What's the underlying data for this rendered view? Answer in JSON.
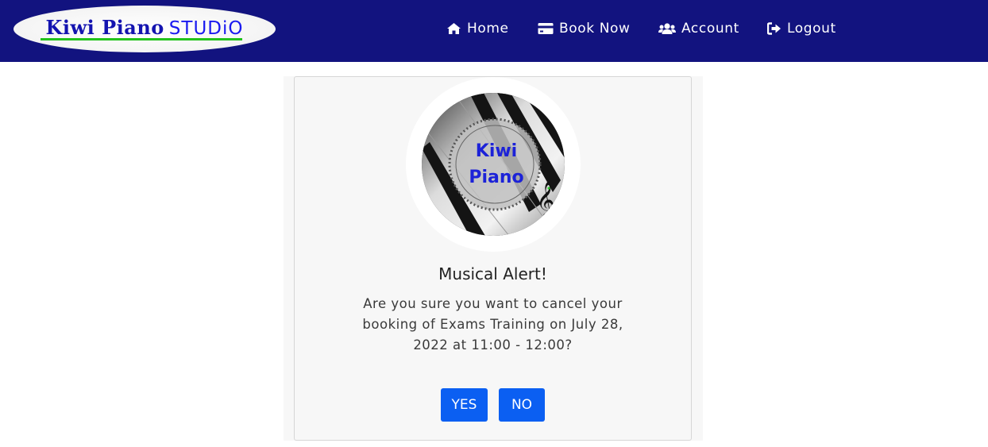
{
  "navbar": {
    "logo": {
      "brand": "Kiwi Piano",
      "suffix": "STUDiO"
    },
    "items": [
      {
        "label": "Home",
        "icon": "home-icon"
      },
      {
        "label": "Book Now",
        "icon": "credit-card-icon"
      },
      {
        "label": "Account",
        "icon": "users-icon"
      },
      {
        "label": "Logout",
        "icon": "sign-out-icon"
      }
    ]
  },
  "dialog": {
    "avatar_text_line1": "Kiwi",
    "avatar_text_line2": "Piano",
    "title": "Musical Alert!",
    "message": "Are you sure you want to cancel your booking of Exams Training on July 28, 2022 at 11:00 - 12:00?",
    "yes_label": "YES",
    "no_label": "NO"
  },
  "colors": {
    "navbar": "#12137f",
    "button": "#0b5ff2",
    "logo_text": "#1414b0",
    "logo_underline": "#22c31c"
  }
}
